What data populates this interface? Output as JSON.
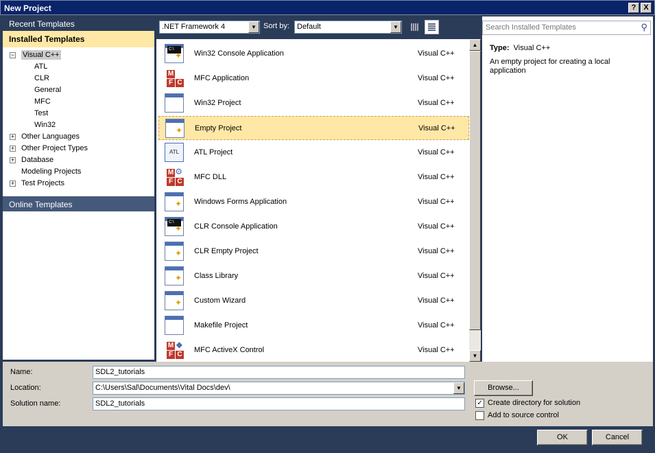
{
  "window": {
    "title": "New Project",
    "help_label": "?",
    "close_label": "X"
  },
  "left": {
    "recent_label": "Recent Templates",
    "installed_label": "Installed Templates",
    "online_label": "Online Templates",
    "tree": [
      {
        "label": "Visual C++",
        "exp": "−",
        "level": 0,
        "selected": true
      },
      {
        "label": "ATL",
        "level": 1
      },
      {
        "label": "CLR",
        "level": 1
      },
      {
        "label": "General",
        "level": 1
      },
      {
        "label": "MFC",
        "level": 1
      },
      {
        "label": "Test",
        "level": 1
      },
      {
        "label": "Win32",
        "level": 1
      },
      {
        "label": "Other Languages",
        "exp": "+",
        "level": 0
      },
      {
        "label": "Other Project Types",
        "exp": "+",
        "level": 0
      },
      {
        "label": "Database",
        "exp": "+",
        "level": 0
      },
      {
        "label": "Modeling Projects",
        "level": 0
      },
      {
        "label": "Test Projects",
        "exp": "+",
        "level": 0
      }
    ]
  },
  "toolbar": {
    "framework_value": ".NET Framework 4",
    "sort_label": "Sort by:",
    "sort_value": "Default"
  },
  "templates": [
    {
      "name": "Win32 Console Application",
      "lang": "Visual C++",
      "icon": "console-app-icon"
    },
    {
      "name": "MFC Application",
      "lang": "Visual C++",
      "icon": "mfc-app-icon"
    },
    {
      "name": "Win32 Project",
      "lang": "Visual C++",
      "icon": "win32-project-icon"
    },
    {
      "name": "Empty Project",
      "lang": "Visual C++",
      "icon": "empty-project-icon",
      "selected": true
    },
    {
      "name": "ATL Project",
      "lang": "Visual C++",
      "icon": "atl-project-icon"
    },
    {
      "name": "MFC DLL",
      "lang": "Visual C++",
      "icon": "mfc-dll-icon"
    },
    {
      "name": "Windows Forms Application",
      "lang": "Visual C++",
      "icon": "windows-forms-icon"
    },
    {
      "name": "CLR Console Application",
      "lang": "Visual C++",
      "icon": "clr-console-icon"
    },
    {
      "name": "CLR Empty Project",
      "lang": "Visual C++",
      "icon": "clr-empty-icon"
    },
    {
      "name": "Class Library",
      "lang": "Visual C++",
      "icon": "class-library-icon"
    },
    {
      "name": "Custom Wizard",
      "lang": "Visual C++",
      "icon": "custom-wizard-icon"
    },
    {
      "name": "Makefile Project",
      "lang": "Visual C++",
      "icon": "makefile-project-icon"
    },
    {
      "name": "MFC ActiveX Control",
      "lang": "Visual C++",
      "icon": "mfc-activex-icon"
    }
  ],
  "right": {
    "search_placeholder": "Search Installed Templates",
    "type_label": "Type:",
    "type_value": "Visual C++",
    "description": "An empty project for creating a local application"
  },
  "form": {
    "name_label": "Name:",
    "name_value": "SDL2_tutorials",
    "location_label": "Location:",
    "location_value": "C:\\Users\\Sal\\Documents\\Vital Docs\\dev\\",
    "solution_label": "Solution name:",
    "solution_value": "SDL2_tutorials",
    "browse_label": "Browse...",
    "create_dir_label": "Create directory for solution",
    "create_dir_checked": true,
    "source_control_label": "Add to source control",
    "source_control_checked": false,
    "ok_label": "OK",
    "cancel_label": "Cancel"
  },
  "colors": {
    "selection": "#ffe8a6",
    "frame": "#2b3c59",
    "titlebar": "#0a246a"
  }
}
